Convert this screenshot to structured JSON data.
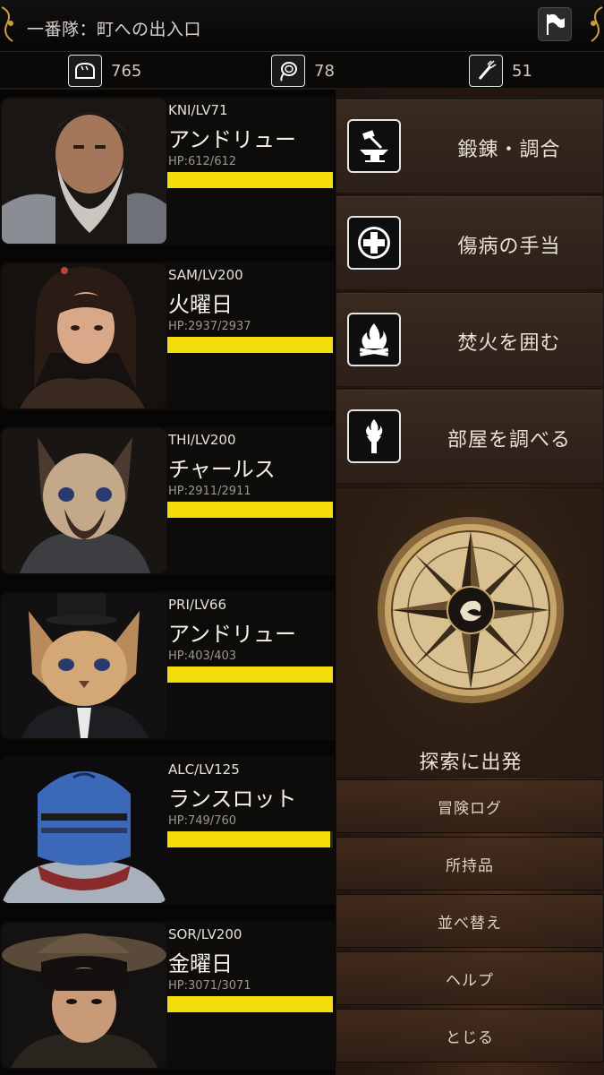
{
  "header": {
    "location": "一番隊：町への出入口",
    "flag_icon": "flag-icon"
  },
  "resources": [
    {
      "icon": "bread-icon",
      "value": "765"
    },
    {
      "icon": "rope-icon",
      "value": "78"
    },
    {
      "icon": "torch-stick-icon",
      "value": "51"
    }
  ],
  "party": [
    {
      "class_level": "KNI/LV71",
      "name": "アンドリュー",
      "hp_text": "HP:612/612",
      "hp_fraction": 1.0,
      "portrait": "bearded-warrior"
    },
    {
      "class_level": "SAM/LV200",
      "name": "火曜日",
      "hp_text": "HP:2937/2937",
      "hp_fraction": 1.0,
      "portrait": "samurai-girl"
    },
    {
      "class_level": "THI/LV200",
      "name": "チャールス",
      "hp_text": "HP:2911/2911",
      "hp_fraction": 1.0,
      "portrait": "siamese-cat"
    },
    {
      "class_level": "PRI/LV66",
      "name": "アンドリュー",
      "hp_text": "HP:403/403",
      "hp_fraction": 1.0,
      "portrait": "tabby-cat-tophat"
    },
    {
      "class_level": "ALC/LV125",
      "name": "ランスロット",
      "hp_text": "HP:749/760",
      "hp_fraction": 0.986,
      "portrait": "knight-helmet"
    },
    {
      "class_level": "SOR/LV200",
      "name": "金曜日",
      "hp_text": "HP:3071/3071",
      "hp_fraction": 1.0,
      "portrait": "straw-hat-youth"
    }
  ],
  "actions": [
    {
      "label": "鍛錬・調合",
      "icon": "anvil-hammer-icon"
    },
    {
      "label": "傷病の手当",
      "icon": "medical-cross-icon"
    },
    {
      "label": "焚火を囲む",
      "icon": "campfire-icon"
    },
    {
      "label": "部屋を調べる",
      "icon": "torch-icon"
    }
  ],
  "explore": {
    "label": "探索に出発",
    "icon": "compass-icon"
  },
  "submenu": [
    {
      "label": "冒険ログ"
    },
    {
      "label": "所持品"
    },
    {
      "label": "並べ替え"
    },
    {
      "label": "ヘルプ"
    },
    {
      "label": "とじる"
    }
  ],
  "colors": {
    "hp_bar": "#f4dd0a",
    "panel": "#3a2a20",
    "background": "#0a0807"
  }
}
